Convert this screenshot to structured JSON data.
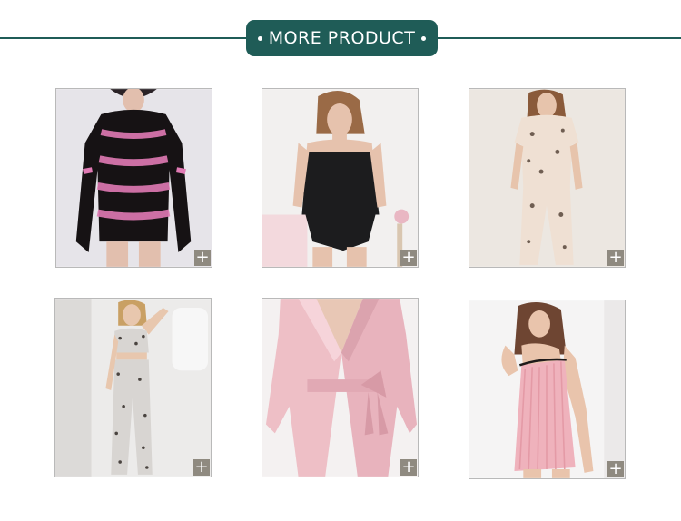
{
  "header": {
    "title": "MORE PRODUCT"
  },
  "accent_color": "#1f5c57",
  "products": [
    {
      "icon": "plus-icon",
      "plus_label": "+"
    },
    {
      "icon": "plus-icon",
      "plus_label": "+"
    },
    {
      "icon": "plus-icon",
      "plus_label": "+"
    },
    {
      "icon": "plus-icon",
      "plus_label": "+"
    },
    {
      "icon": "plus-icon",
      "plus_label": "+"
    },
    {
      "icon": "plus-icon",
      "plus_label": "+"
    }
  ]
}
